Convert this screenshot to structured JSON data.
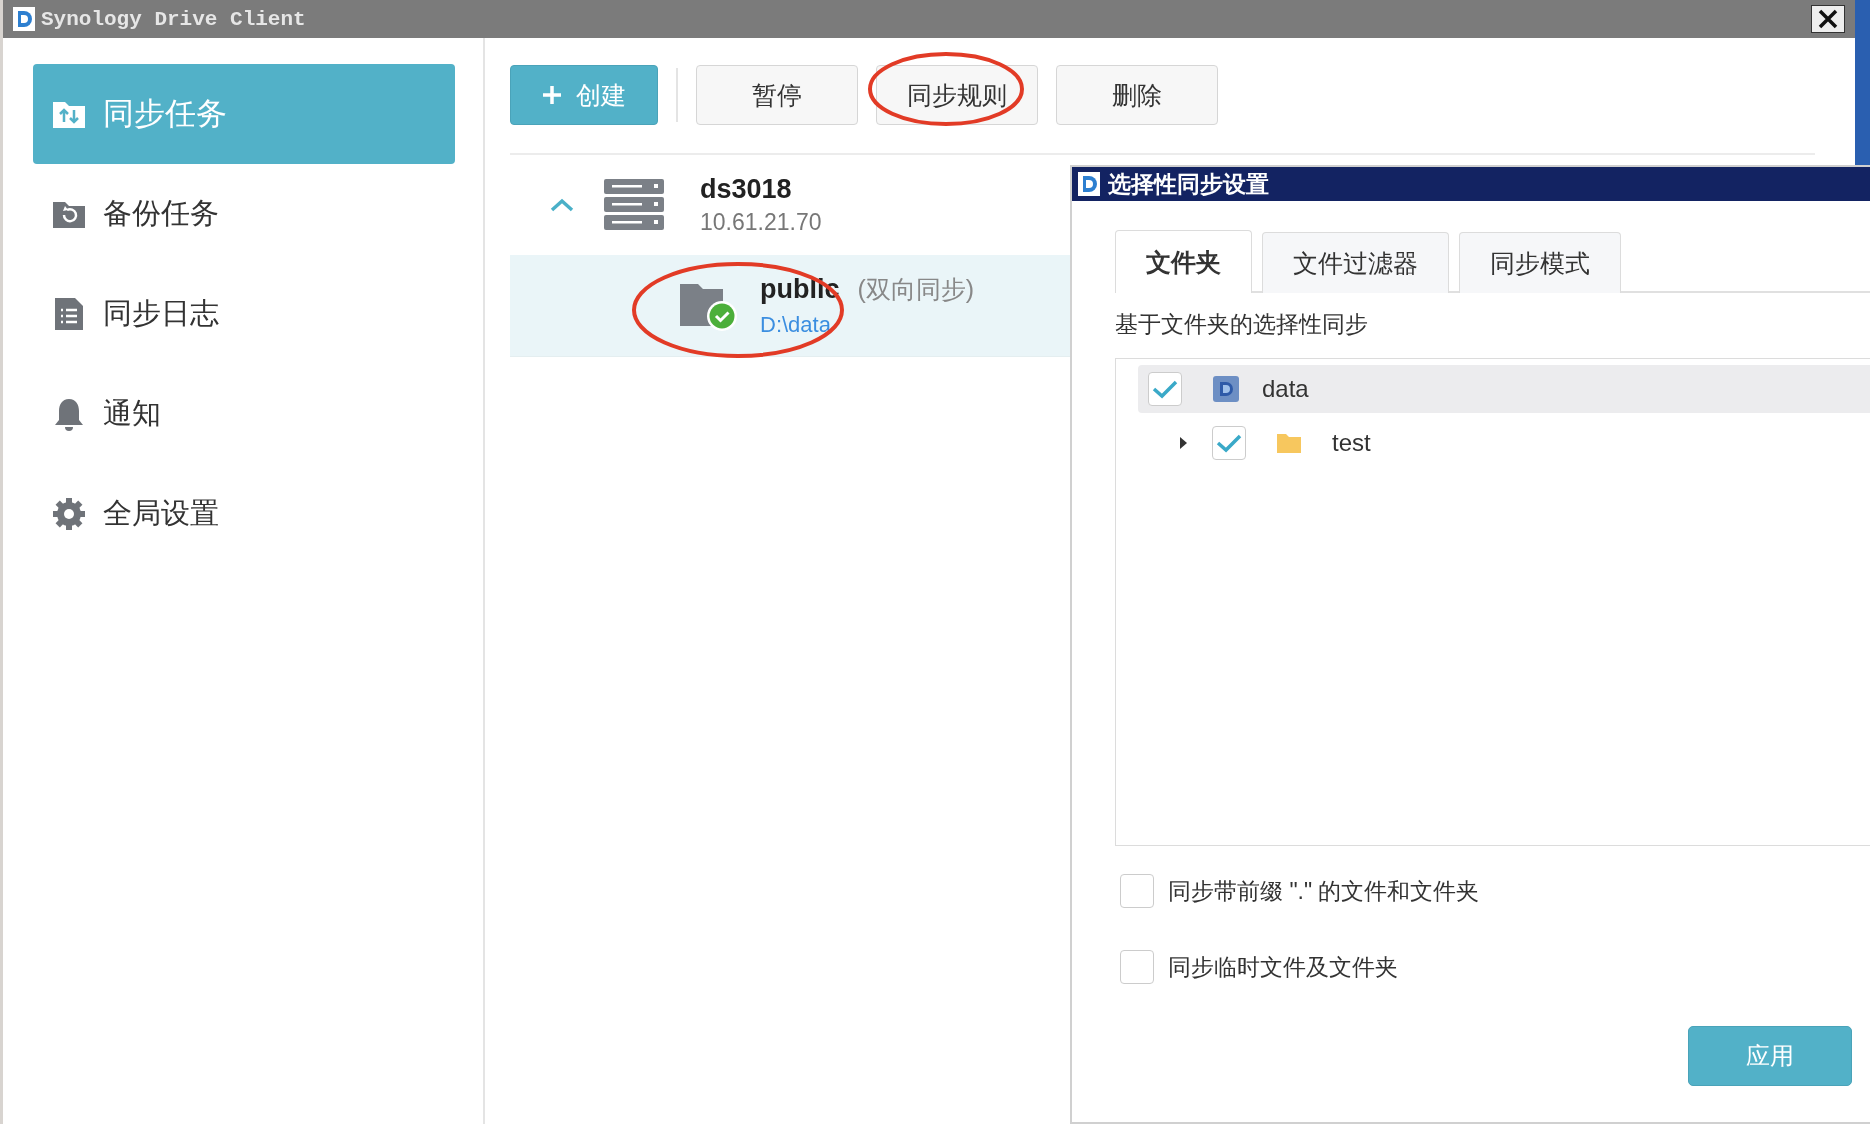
{
  "window": {
    "title": "Synology Drive Client"
  },
  "sidebar": {
    "items": [
      {
        "label": "同步任务",
        "selected": true
      },
      {
        "label": "备份任务",
        "selected": false
      },
      {
        "label": "同步日志",
        "selected": false
      },
      {
        "label": "通知",
        "selected": false
      },
      {
        "label": "全局设置",
        "selected": false
      }
    ]
  },
  "toolbar": {
    "buttons": [
      {
        "label": "创建",
        "kind": "primary"
      },
      {
        "label": "暂停",
        "kind": "default"
      },
      {
        "label": "同步规则",
        "kind": "default"
      },
      {
        "label": "删除",
        "kind": "default"
      }
    ]
  },
  "server": {
    "name": "ds3018",
    "address": "10.61.21.70",
    "expanded": true,
    "tasks": [
      {
        "name": "public",
        "mode": "(双向同步)",
        "path": "D:\\data",
        "selected": true,
        "synced": true
      }
    ]
  },
  "dialog": {
    "title": "选择性同步设置",
    "tabs": [
      {
        "label": "文件夹",
        "selected": true
      },
      {
        "label": "文件过滤器",
        "selected": false
      },
      {
        "label": "同步模式",
        "selected": false
      }
    ],
    "description": "基于文件夹的选择性同步",
    "tree": [
      {
        "label": "data",
        "checked": true,
        "selected": true,
        "children": [
          {
            "label": "test",
            "checked": true,
            "selected": false,
            "expanded": false
          }
        ]
      }
    ],
    "options": [
      {
        "label": "同步带前缀 \".\" 的文件和文件夹",
        "checked": false
      },
      {
        "label": "同步临时文件及文件夹",
        "checked": false
      }
    ],
    "apply_button": "应用"
  }
}
